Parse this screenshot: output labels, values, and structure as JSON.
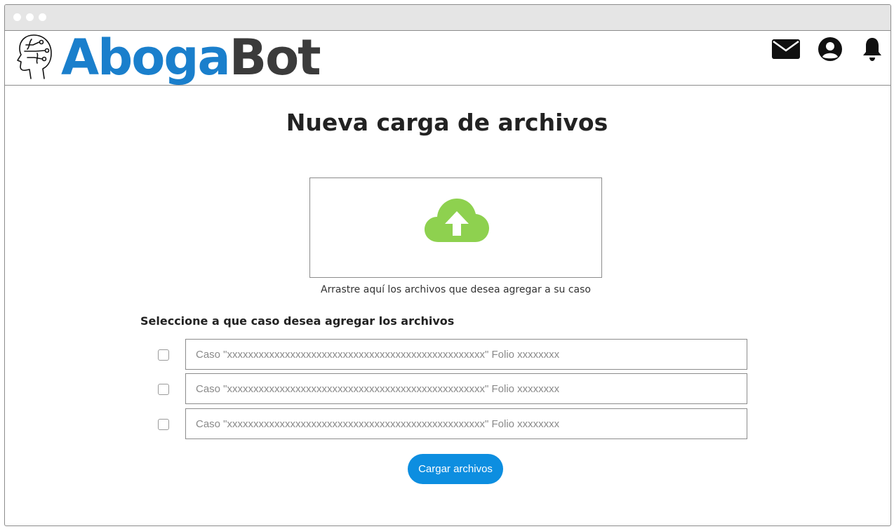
{
  "brand": {
    "part1": "Aboga",
    "part2": "Bot"
  },
  "header": {
    "icons": [
      "mail-icon",
      "user-account-icon",
      "bell-icon"
    ]
  },
  "page": {
    "title": "Nueva carga de archivos",
    "dropzone_hint": "Arrastre aquí los archivos que desea agregar a su caso",
    "select_label": "Seleccione a que caso desea agregar los archivos",
    "cases": [
      {
        "placeholder": "Caso \"xxxxxxxxxxxxxxxxxxxxxxxxxxxxxxxxxxxxxxxxxxxxxxxxx\" Folio xxxxxxxx",
        "checked": false
      },
      {
        "placeholder": "Caso \"xxxxxxxxxxxxxxxxxxxxxxxxxxxxxxxxxxxxxxxxxxxxxxxxx\" Folio xxxxxxxx",
        "checked": false
      },
      {
        "placeholder": "Caso \"xxxxxxxxxxxxxxxxxxxxxxxxxxxxxxxxxxxxxxxxxxxxxxxxx\" Folio xxxxxxxx",
        "checked": false
      }
    ],
    "submit_label": "Cargar archivos"
  },
  "colors": {
    "brand_blue": "#1a7fcc",
    "brand_dark": "#3b3b3b",
    "upload_green": "#8ed14f",
    "button_blue": "#0d8ee0"
  }
}
